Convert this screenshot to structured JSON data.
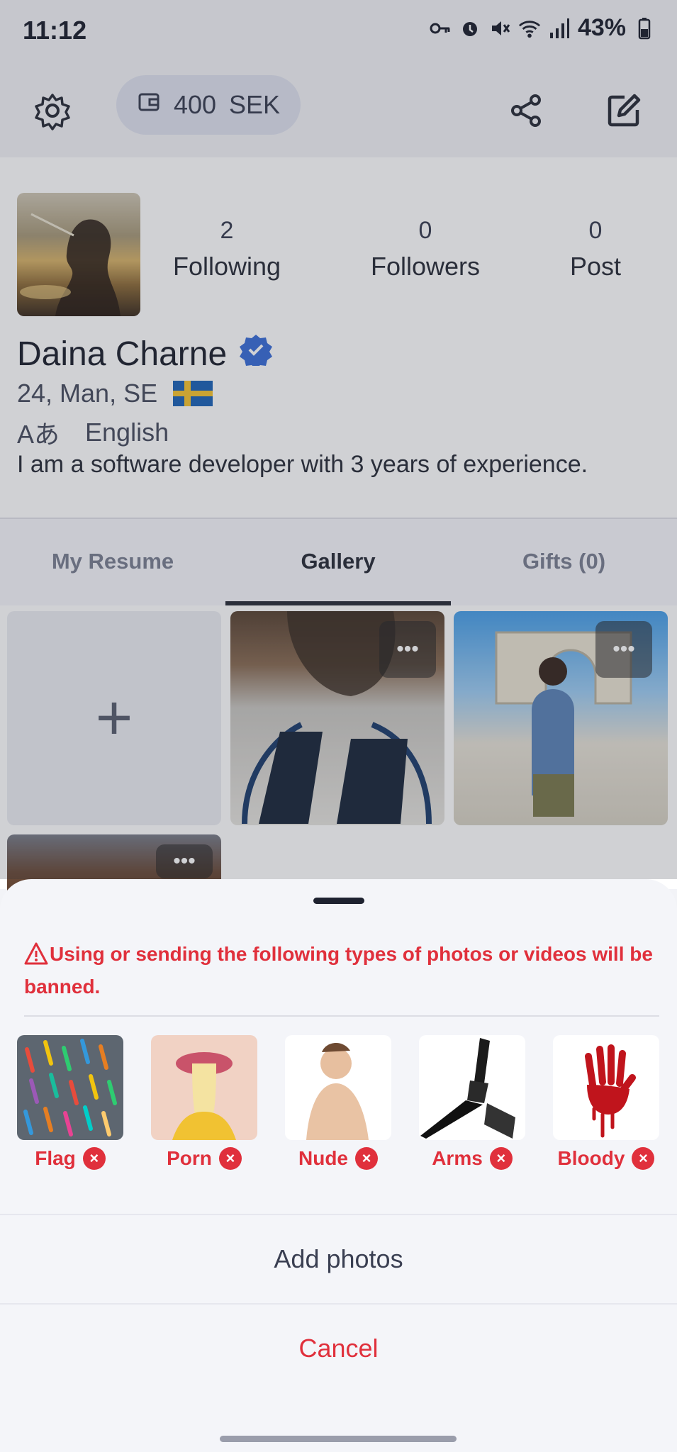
{
  "status_bar": {
    "time": "11:12",
    "battery": "43%"
  },
  "header": {
    "wallet_amount": "400",
    "wallet_currency": "SEK",
    "icons": [
      "settings-gear-icon",
      "wallet-icon",
      "share-icon",
      "edit-icon"
    ]
  },
  "profile": {
    "stats": [
      {
        "num": "2",
        "label": "Following"
      },
      {
        "num": "0",
        "label": "Followers"
      },
      {
        "num": "0",
        "label": "Post"
      }
    ],
    "name": "Daina Charne",
    "details": "24, Man, SE",
    "language_icon": "Aあ",
    "language": "English",
    "bio": "I am a software developer with 3 years of experience."
  },
  "tabs": [
    {
      "label": "My Resume"
    },
    {
      "label": "Gallery"
    },
    {
      "label": "Gifts (0)"
    }
  ],
  "gallery": {
    "add_symbol": "+",
    "more_symbol": "•••"
  },
  "sheet": {
    "warning": "Using or sending the following types of photos or videos will be banned.",
    "banned": [
      {
        "label": "Flag"
      },
      {
        "label": "Porn"
      },
      {
        "label": "Nude"
      },
      {
        "label": "Arms"
      },
      {
        "label": "Bloody"
      }
    ],
    "x_symbol": "×",
    "add_photos": "Add photos",
    "cancel": "Cancel"
  },
  "colors": {
    "accent_red": "#e0303c",
    "verified_blue": "#3b6fd8",
    "chip_bg": "#dfe2ef"
  }
}
